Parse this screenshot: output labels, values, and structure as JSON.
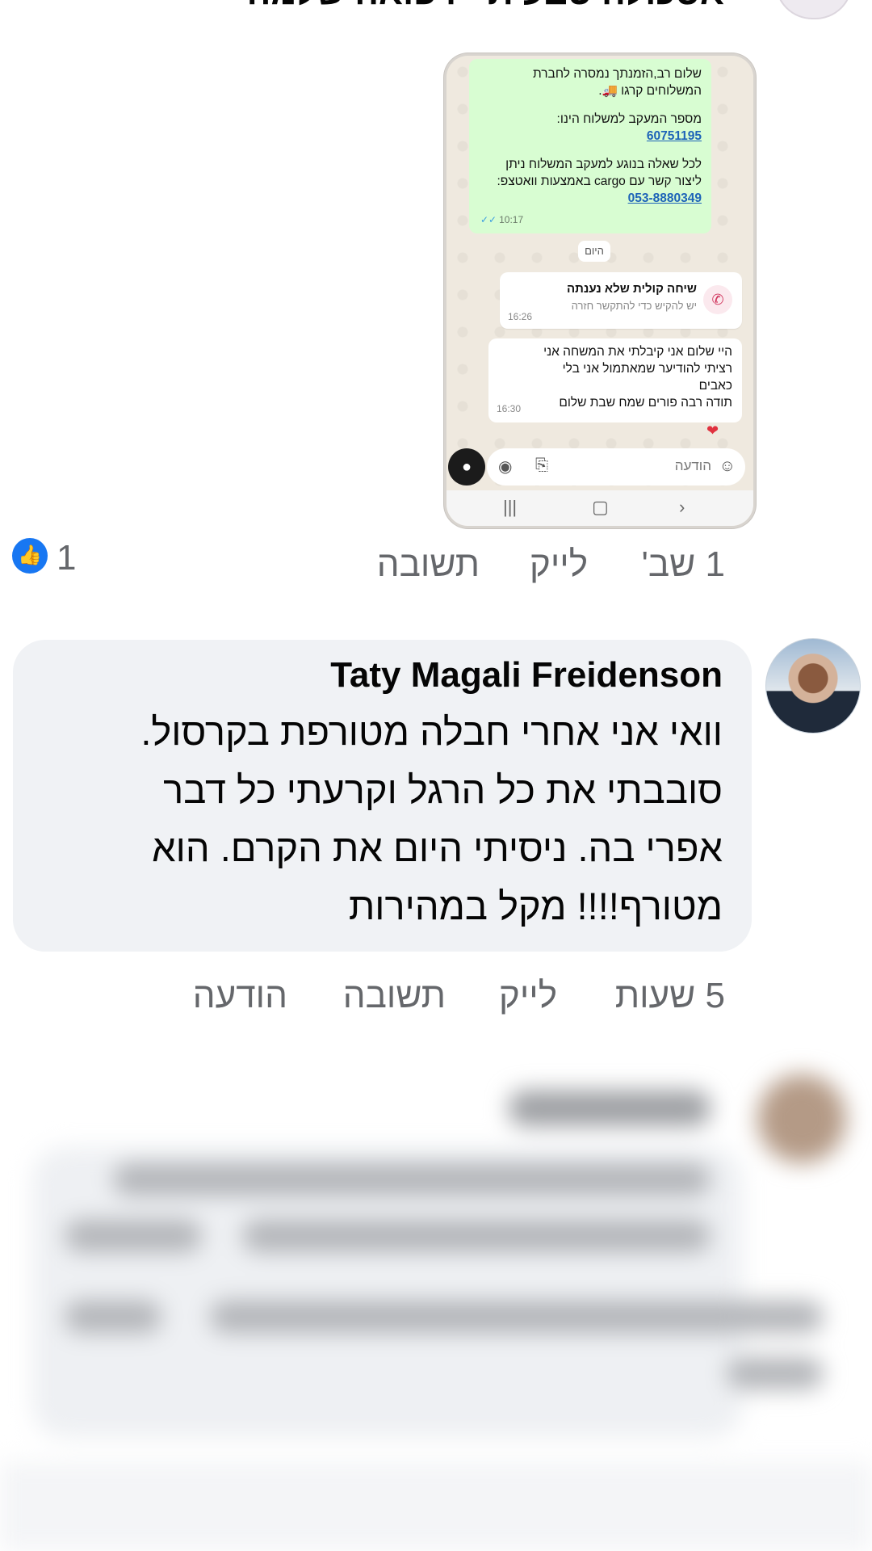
{
  "prev_comment": {
    "author": "אסכולה טבעית - רפואה שלמה",
    "attachment": {
      "green_msg_line1": "שלום רב,הזמנתך נמסרה לחברת",
      "green_msg_line2": "המשלוחים קרגו 🚚.",
      "tracking_label": "מספר המעקב למשלוח הינו:",
      "tracking_number": "60751195",
      "contact_line1": "לכל שאלה בנוגע למעקב המשלוח ניתן",
      "contact_line2": "ליצור קשר עם cargo באמצעות וואטצפ:",
      "contact_phone": "053-8880349",
      "green_time": "10:17",
      "day_label": "היום",
      "call_title": "שיחה קולית שלא נענתה",
      "call_subtitle": "יש להקיש כדי להתקשר חזרה",
      "call_time": "16:26",
      "reply_line1": "היי שלום אני קיבלתי את המשחה אני",
      "reply_line2": "רציתי להודיער שמאתמול אני בלי",
      "reply_line3": "כאבים",
      "reply_line4": "תודה רבה פורים שמח שבת שלום",
      "reply_time": "16:30",
      "input_placeholder": "הודעה"
    },
    "time": "1 שב'",
    "like_label": "לייק",
    "reply_label": "תשובה",
    "like_count": "1"
  },
  "comment": {
    "author": "Taty Magali Freidenson",
    "text_line1": "וואי אני אחרי חבלה מטורפת בקרסול.",
    "text_line2": "סובבתי את כל הרגל וקרעתי כל דבר",
    "text_line3": "אפרי בה. ניסיתי היום את הקרם. הוא",
    "text_line4": "מטורף!!!! מקל במהירות",
    "time": "5 שעות",
    "like_label": "לייק",
    "reply_label": "תשובה",
    "message_label": "הודעה"
  },
  "colors": {
    "like_blue": "#1877f2",
    "secondary_text": "#65676b",
    "bubble_bg": "#f0f2f5"
  }
}
